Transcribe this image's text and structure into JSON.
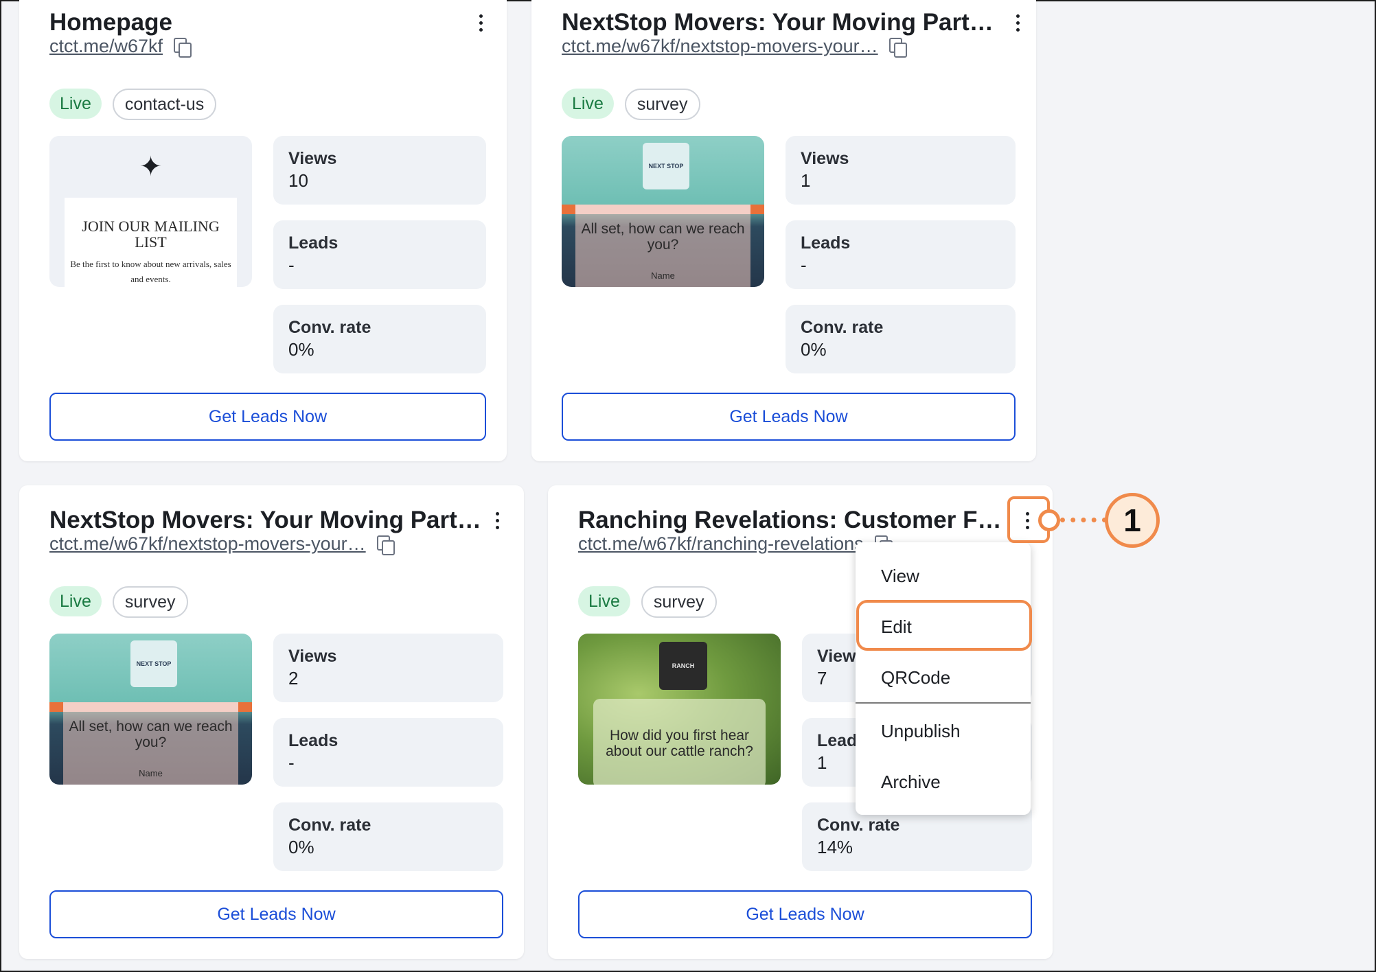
{
  "cards": [
    {
      "title": "Homepage",
      "url": "ctct.me/w67kf",
      "status": "Live",
      "tag": "contact-us",
      "thumb": {
        "heading": "JOIN OUR MAILING LIST",
        "text": "Be the first to know about new arrivals, sales and events."
      },
      "views_label": "Views",
      "views": "10",
      "leads_label": "Leads",
      "leads": "-",
      "conv_label": "Conv. rate",
      "conv": "0%",
      "cta": "Get Leads Now"
    },
    {
      "title": "NextStop Movers: Your Moving Partne…",
      "url": "ctct.me/w67kf/nextstop-movers-your…",
      "status": "Live",
      "tag": "survey",
      "thumb": {
        "logo": "NEXT STOP",
        "question": "All set, how can we reach you?",
        "field": "Name"
      },
      "views_label": "Views",
      "views": "1",
      "leads_label": "Leads",
      "leads": "-",
      "conv_label": "Conv. rate",
      "conv": "0%",
      "cta": "Get Leads Now"
    },
    {
      "title": "NextStop Movers: Your Moving Partne…",
      "url": "ctct.me/w67kf/nextstop-movers-your…",
      "status": "Live",
      "tag": "survey",
      "thumb": {
        "logo": "NEXT STOP",
        "question": "All set, how can we reach you?",
        "field": "Name"
      },
      "views_label": "Views",
      "views": "2",
      "leads_label": "Leads",
      "leads": "-",
      "conv_label": "Conv. rate",
      "conv": "0%",
      "cta": "Get Leads Now"
    },
    {
      "title": "Ranching Revelations: Customer Feed…",
      "url": "ctct.me/w67kf/ranching-revelations",
      "status": "Live",
      "tag": "survey",
      "thumb": {
        "logo": "RANCH",
        "question": "How did you first hear about our cattle ranch?"
      },
      "views_label": "Views",
      "views": "7",
      "leads_label": "Leads",
      "leads": "1",
      "conv_label": "Conv. rate",
      "conv": "14%",
      "cta": "Get Leads Now"
    }
  ],
  "menu": {
    "items": [
      "View",
      "Edit",
      "QRCode",
      "Unpublish",
      "Archive"
    ]
  },
  "callout": {
    "number": "1",
    "color": "#f08a4b"
  },
  "colors": {
    "accent": "#1b4ed8",
    "live_bg": "#d7f5e3",
    "live_text": "#1a7a42",
    "highlight": "#f08a4b"
  }
}
